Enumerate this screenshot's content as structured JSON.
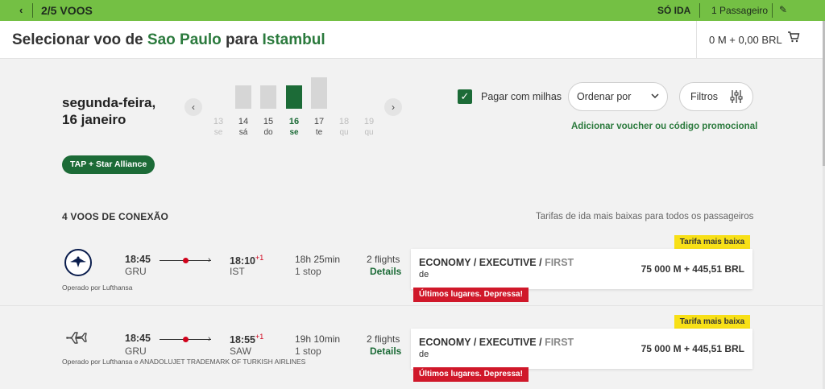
{
  "topbar": {
    "back_icon": "chevron-left-icon",
    "step": "2/5 VOOS",
    "trip_type": "SÓ IDA",
    "passengers": "1 Passageiro",
    "edit_icon": "pencil-icon"
  },
  "header": {
    "title_prefix": "Selecionar voo de ",
    "origin": "Sao Paulo",
    "title_mid": " para ",
    "destination": "Istambul",
    "cart_total": "0 M + 0,00 BRL",
    "cart_icon": "cart-icon"
  },
  "date_selector": {
    "date_line1": "segunda-feira,",
    "date_line2": "16 janeiro",
    "prev_icon": "chevron-left-icon",
    "next_icon": "chevron-right-icon",
    "days": [
      {
        "num": "13",
        "wd": "se"
      },
      {
        "num": "14",
        "wd": "sá"
      },
      {
        "num": "15",
        "wd": "do"
      },
      {
        "num": "16",
        "wd": "se"
      },
      {
        "num": "17",
        "wd": "te"
      },
      {
        "num": "18",
        "wd": "qu"
      },
      {
        "num": "19",
        "wd": "qu"
      }
    ],
    "selected_day": "16"
  },
  "tag": "TAP + Star Alliance",
  "options": {
    "miles_label": "Pagar com milhas",
    "miles_checked": true,
    "sort_label": "Ordenar por",
    "filters_label": "Filtros",
    "promo_link": "Adicionar voucher ou código promocional"
  },
  "results": {
    "title": "4 VOOS DE CONEXÃO",
    "note": "Tarifas de ida mais baixas para todos os passageiros",
    "flights": [
      {
        "logo_icon": "lufthansa-logo-icon",
        "operated_by": "Operado por Lufthansa",
        "dep_time": "18:45",
        "dep_code": "GRU",
        "arr_time": "18:10",
        "day_offset": "+1",
        "arr_code": "IST",
        "duration": "18h 25min",
        "stops": "1 stop",
        "flights_count": "2 flights",
        "details": "Details",
        "badge": "Tarifa mais baixa",
        "class_main": "ECONOMY / EXECUTIVE / ",
        "class_first": "FIRST",
        "from": "de",
        "price": "75 000 M + 445,51 BRL",
        "warning": "Últimos lugares. Depressa!"
      },
      {
        "logo_icon": "airplane-icon",
        "operated_by": "Operado por Lufthansa e ANADOLUJET TRADEMARK OF TURKISH AIRLINES",
        "dep_time": "18:45",
        "dep_code": "GRU",
        "arr_time": "18:55",
        "day_offset": "+1",
        "arr_code": "SAW",
        "duration": "19h 10min",
        "stops": "1 stop",
        "flights_count": "2 flights",
        "details": "Details",
        "badge": "Tarifa mais baixa",
        "class_main": "ECONOMY / EXECUTIVE / ",
        "class_first": "FIRST",
        "from": "de",
        "price": "75 000 M + 445,51 BRL",
        "warning": "Últimos lugares. Depressa!"
      }
    ]
  }
}
